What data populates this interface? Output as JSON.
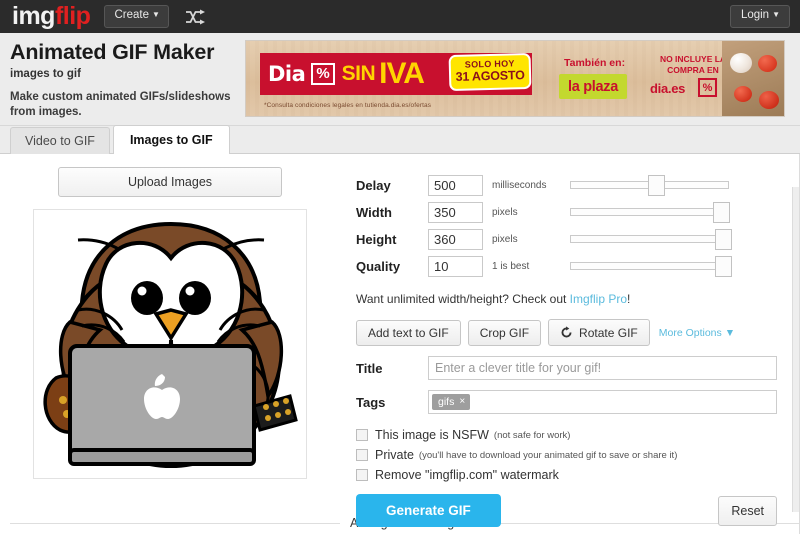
{
  "topnav": {
    "logo_img": "img",
    "logo_flip": "flip",
    "create_label": "Create",
    "create_caret": "▼",
    "shuffle_icon": "shuffle-icon",
    "login_label": "Login",
    "login_caret": "▼"
  },
  "header": {
    "title": "Animated GIF Maker",
    "subtitle": "images to gif",
    "description": "Make custom animated GIFs/slideshows from images."
  },
  "ad": {
    "brand": "Dia",
    "percent_symbol": "%",
    "sin": "SIN",
    "iva": "IVA",
    "badge_line1": "SOLO HOY",
    "badge_line2": "31 AGOSTO",
    "legal": "*Consulta condiciones legales en tutienda.dia.es/ofertas",
    "tambien": "También en:",
    "plaza": "la plaza",
    "no_incluye": "NO INCLUYE LA COMPRA EN",
    "dia_es": "dia.es",
    "cart_symbol": "%"
  },
  "tabs": [
    {
      "label": "Video to GIF",
      "active": false
    },
    {
      "label": "Images to GIF",
      "active": true
    }
  ],
  "left": {
    "upload_label": "Upload Images",
    "preview_alt": "owl-with-laptop-image"
  },
  "settings": [
    {
      "label": "Delay",
      "value": "500",
      "unit": "milliseconds",
      "slider_pct": 52
    },
    {
      "label": "Width",
      "value": "350",
      "unit": "pixels",
      "slider_pct": 94
    },
    {
      "label": "Height",
      "value": "360",
      "unit": "pixels",
      "slider_pct": 95
    },
    {
      "label": "Quality",
      "value": "10",
      "unit": "1 is best",
      "slider_pct": 95
    }
  ],
  "pro": {
    "text": "Want unlimited width/height? Check out ",
    "link": "Imgflip Pro",
    "tail": "!"
  },
  "tools": {
    "add_text": "Add text to GIF",
    "crop": "Crop GIF",
    "rotate": "Rotate GIF",
    "more_options": "More Options",
    "more_caret": "▼"
  },
  "fields": {
    "title_label": "Title",
    "title_value": "",
    "title_placeholder": "Enter a clever title for your gif!",
    "tags_label": "Tags",
    "tag_chip": "gifs",
    "tag_remove": "×"
  },
  "checkboxes": [
    {
      "label": "This image is NSFW",
      "note": "(not safe for work)",
      "checked": false
    },
    {
      "label": "Private",
      "note": "(you'll have to download your animated gif to save or share it)",
      "checked": false
    },
    {
      "label": "Remove \"imgflip.com\" watermark",
      "note": "",
      "checked": false
    }
  ],
  "actions": {
    "generate": "Generate GIF",
    "reset": "Reset"
  },
  "arrange": {
    "heading": "Arrange Your Images"
  },
  "colors": {
    "nav_bg": "#2b2b2b",
    "logo_red": "#e02020",
    "accent_blue": "#2ab5ec",
    "link_blue": "#5bbbdd",
    "band_bg": "#ececec",
    "ad_red": "#c8102e",
    "ad_yellow": "#ffd400"
  }
}
